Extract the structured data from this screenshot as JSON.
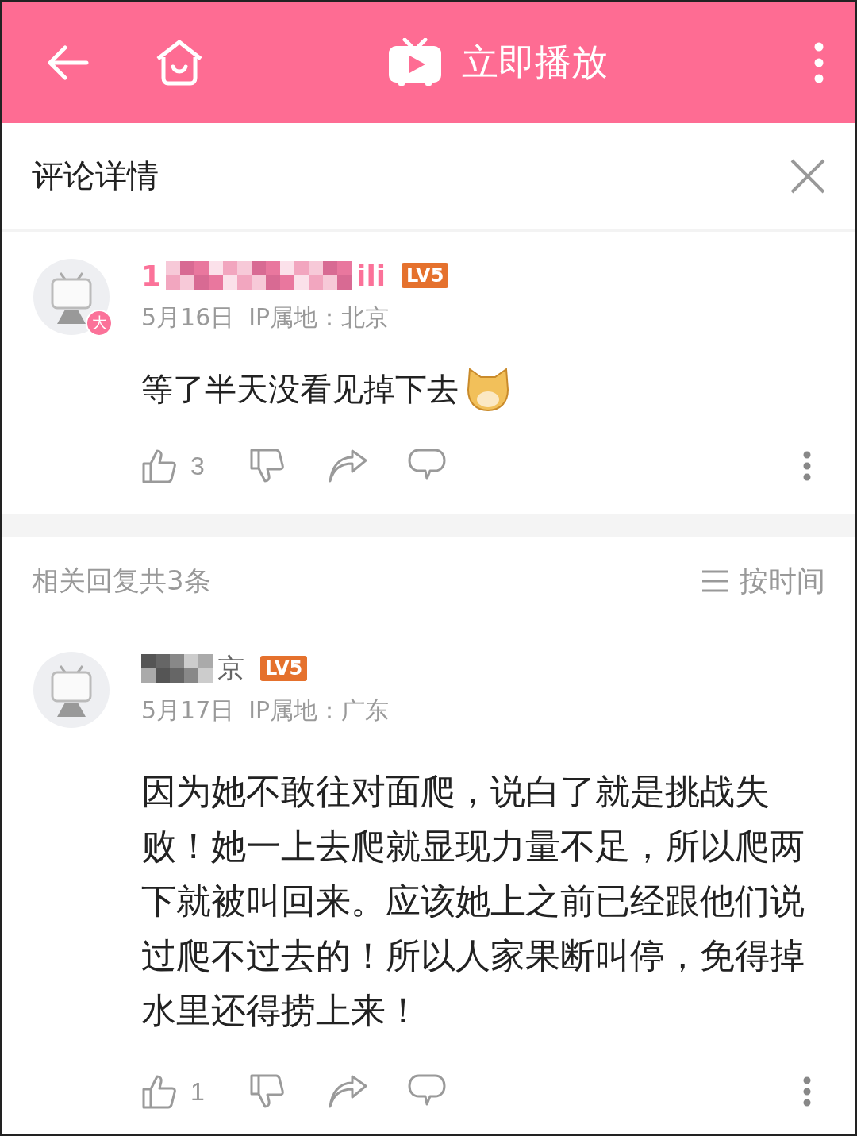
{
  "top_bar": {
    "title": "立即播放"
  },
  "panel": {
    "title": "评论详情"
  },
  "main_comment": {
    "name_start": "1",
    "name_end": "ili",
    "avatar_badge": "大",
    "level_badge": "LV5",
    "date": "5月16日",
    "ip": "IP属地：北京",
    "text": "等了半天没看见掉下去",
    "emoji": true,
    "likes": "3"
  },
  "replies_header": {
    "count_label": "相关回复共3条",
    "sort_label": "按时间"
  },
  "replies": [
    {
      "name_end": "京",
      "level_badge": "LV5",
      "date": "5月17日",
      "ip": "IP属地：广东",
      "text": "因为她不敢往对面爬，说白了就是挑战失败！她一上去爬就显现力量不足，所以爬两下就被叫回来。应该她上之前已经跟他们说过爬不过去的！所以人家果断叫停，免得掉水里还得捞上来！",
      "likes": "1"
    }
  ]
}
